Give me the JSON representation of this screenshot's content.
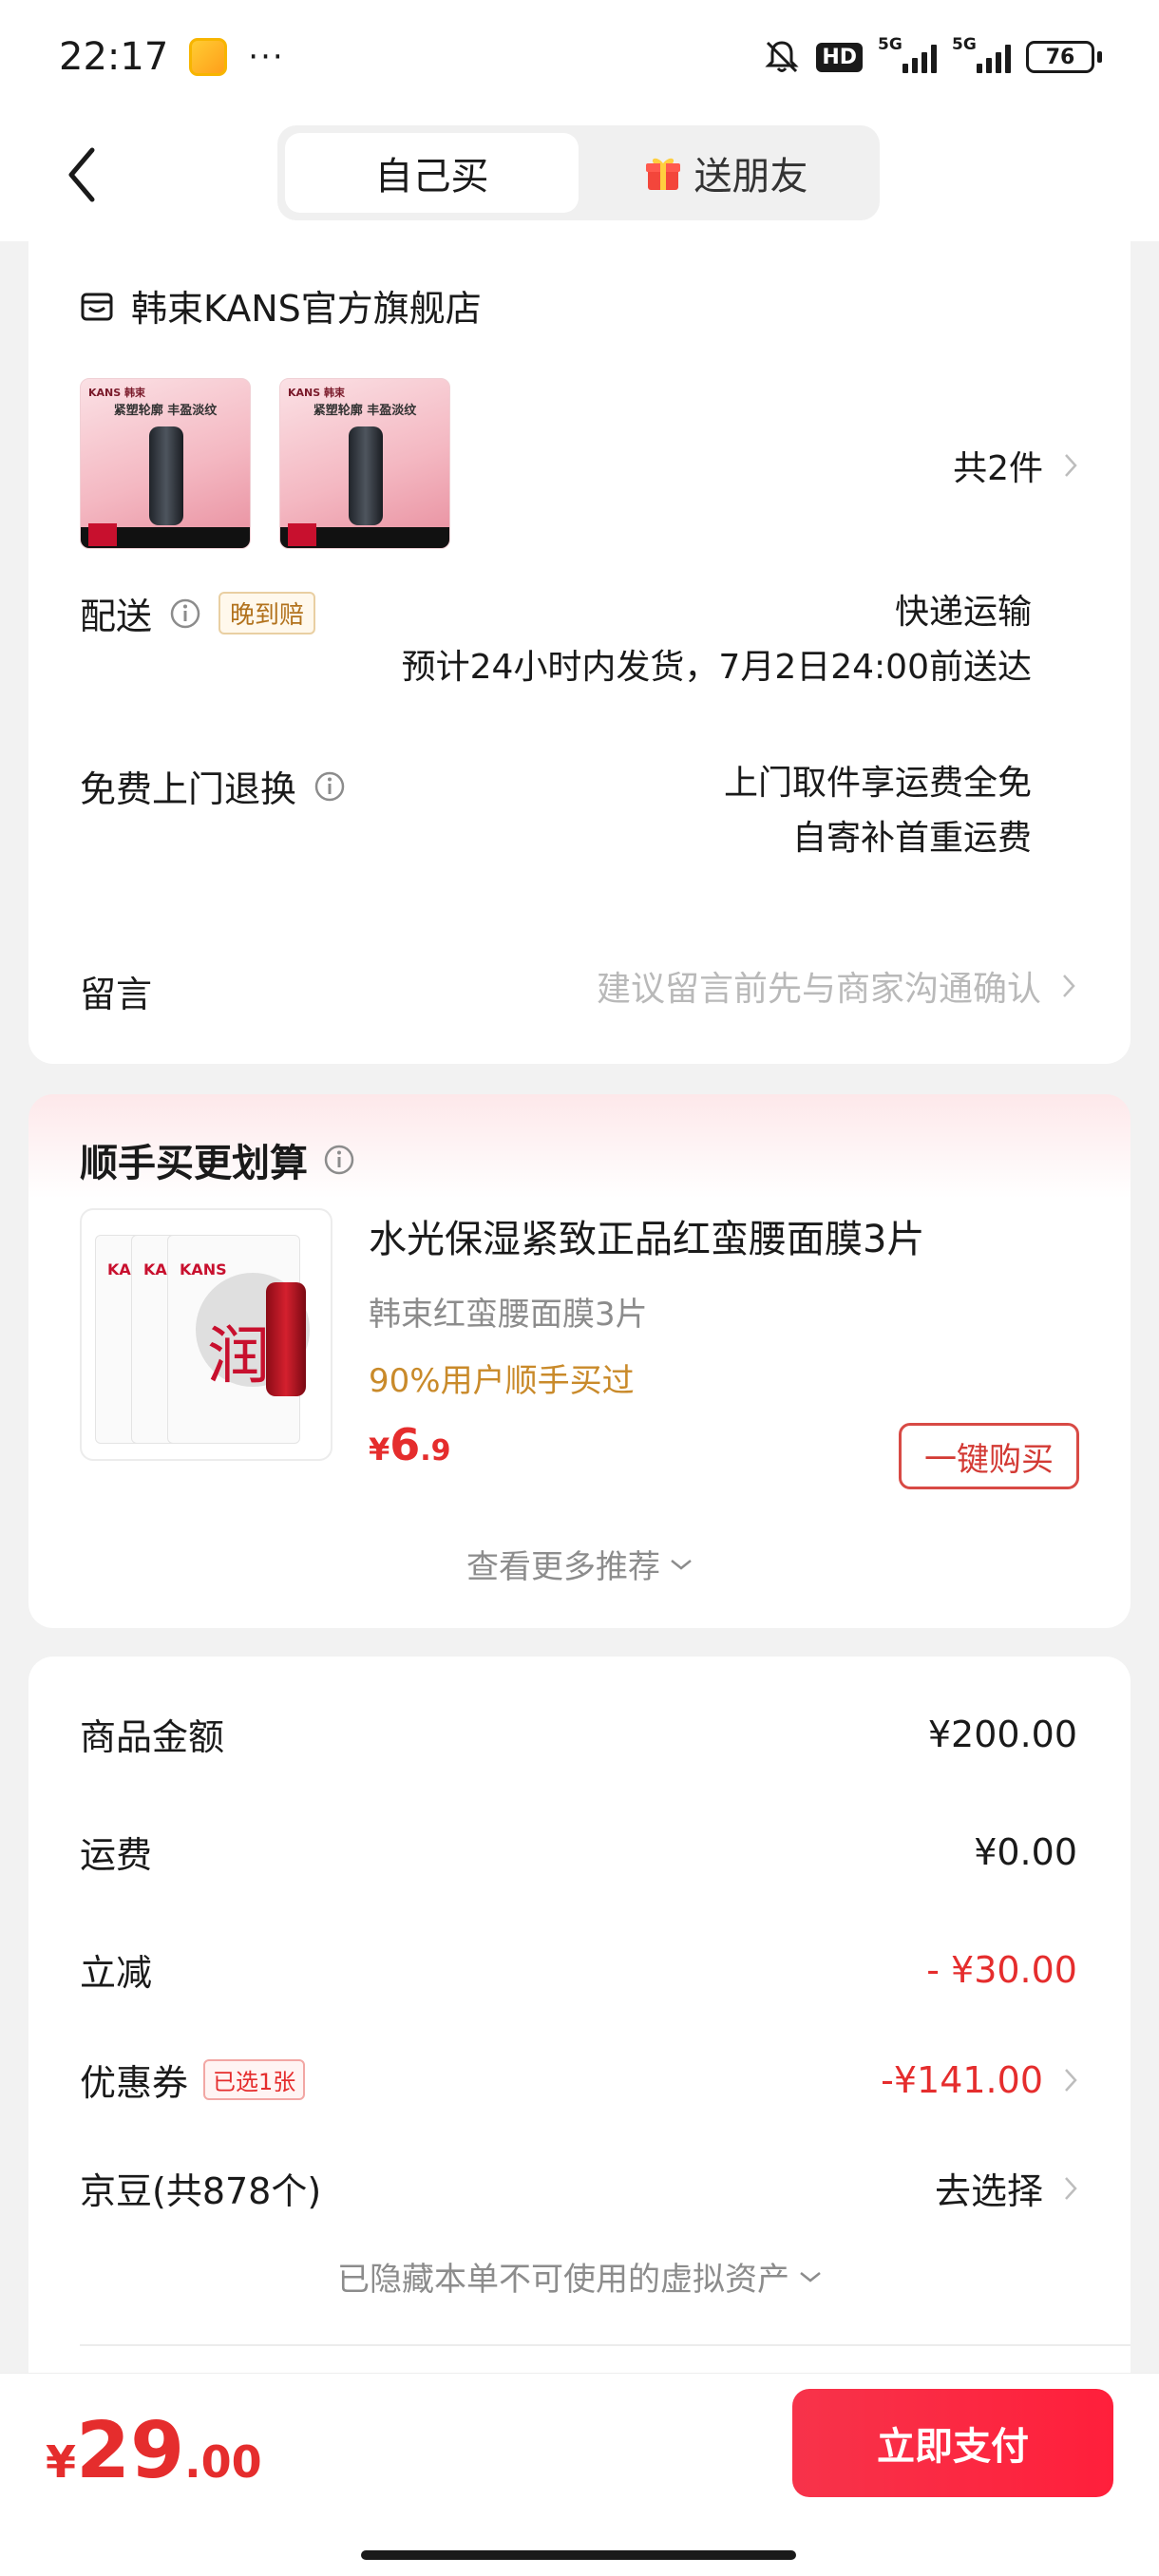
{
  "status_bar": {
    "time": "22:17",
    "more": "···",
    "hd": "HD",
    "net1": "5G",
    "net2": "5G",
    "battery": "76"
  },
  "header": {
    "tabs": [
      {
        "label": "自己买",
        "active": true
      },
      {
        "label": "送朋友",
        "active": false,
        "icon": "gift-icon"
      }
    ]
  },
  "order": {
    "shop_name": "韩束KANS官方旗舰店",
    "item_count": "共2件",
    "thumb_brand": "KANS 韩束",
    "thumb_headline": "紧塑轮廓 丰盈淡纹",
    "delivery_label": "配送",
    "delivery_badge": "晚到赔",
    "delivery_method": "快递运输",
    "delivery_eta": "预计24小时内发货，7月2日24:00前送达",
    "return_label": "免费上门退换",
    "return_line1": "上门取件享运费全免",
    "return_line2": "自寄补首重运费",
    "note_label": "留言",
    "note_placeholder": "建议留言前先与商家沟通确认"
  },
  "recommend": {
    "title": "顺手买更划算",
    "product_name": "水光保湿紧致正品红蛮腰面膜3片",
    "product_sub": "韩束红蛮腰面膜3片",
    "product_tag": "90%用户顺手买过",
    "price_currency": "¥",
    "price_int": "6",
    "price_dec": ".9",
    "buy_label": "一键购买",
    "more_label": "查看更多推荐",
    "img_char": "润",
    "img_brand": "KANS"
  },
  "summary": {
    "rows": [
      {
        "label": "商品金额",
        "value": "¥200.00"
      },
      {
        "label": "运费",
        "value": "¥0.00"
      },
      {
        "label": "立减",
        "value": "- ¥30.00"
      },
      {
        "label": "优惠券",
        "badge": "已选1张",
        "value": "-¥141.00"
      },
      {
        "label": "京豆(共878个)",
        "value": "去选择"
      }
    ],
    "hidden_assets": "已隐藏本单不可使用的虚拟资产"
  },
  "footer": {
    "currency": "¥",
    "total_int": "29",
    "total_dec": ".00",
    "pay_label": "立即支付"
  },
  "colors": {
    "accent_red": "#e52d2d",
    "pay_button": "#ff1f3b",
    "late_badge": "#b2721d",
    "tag_gold": "#c98a2a"
  }
}
